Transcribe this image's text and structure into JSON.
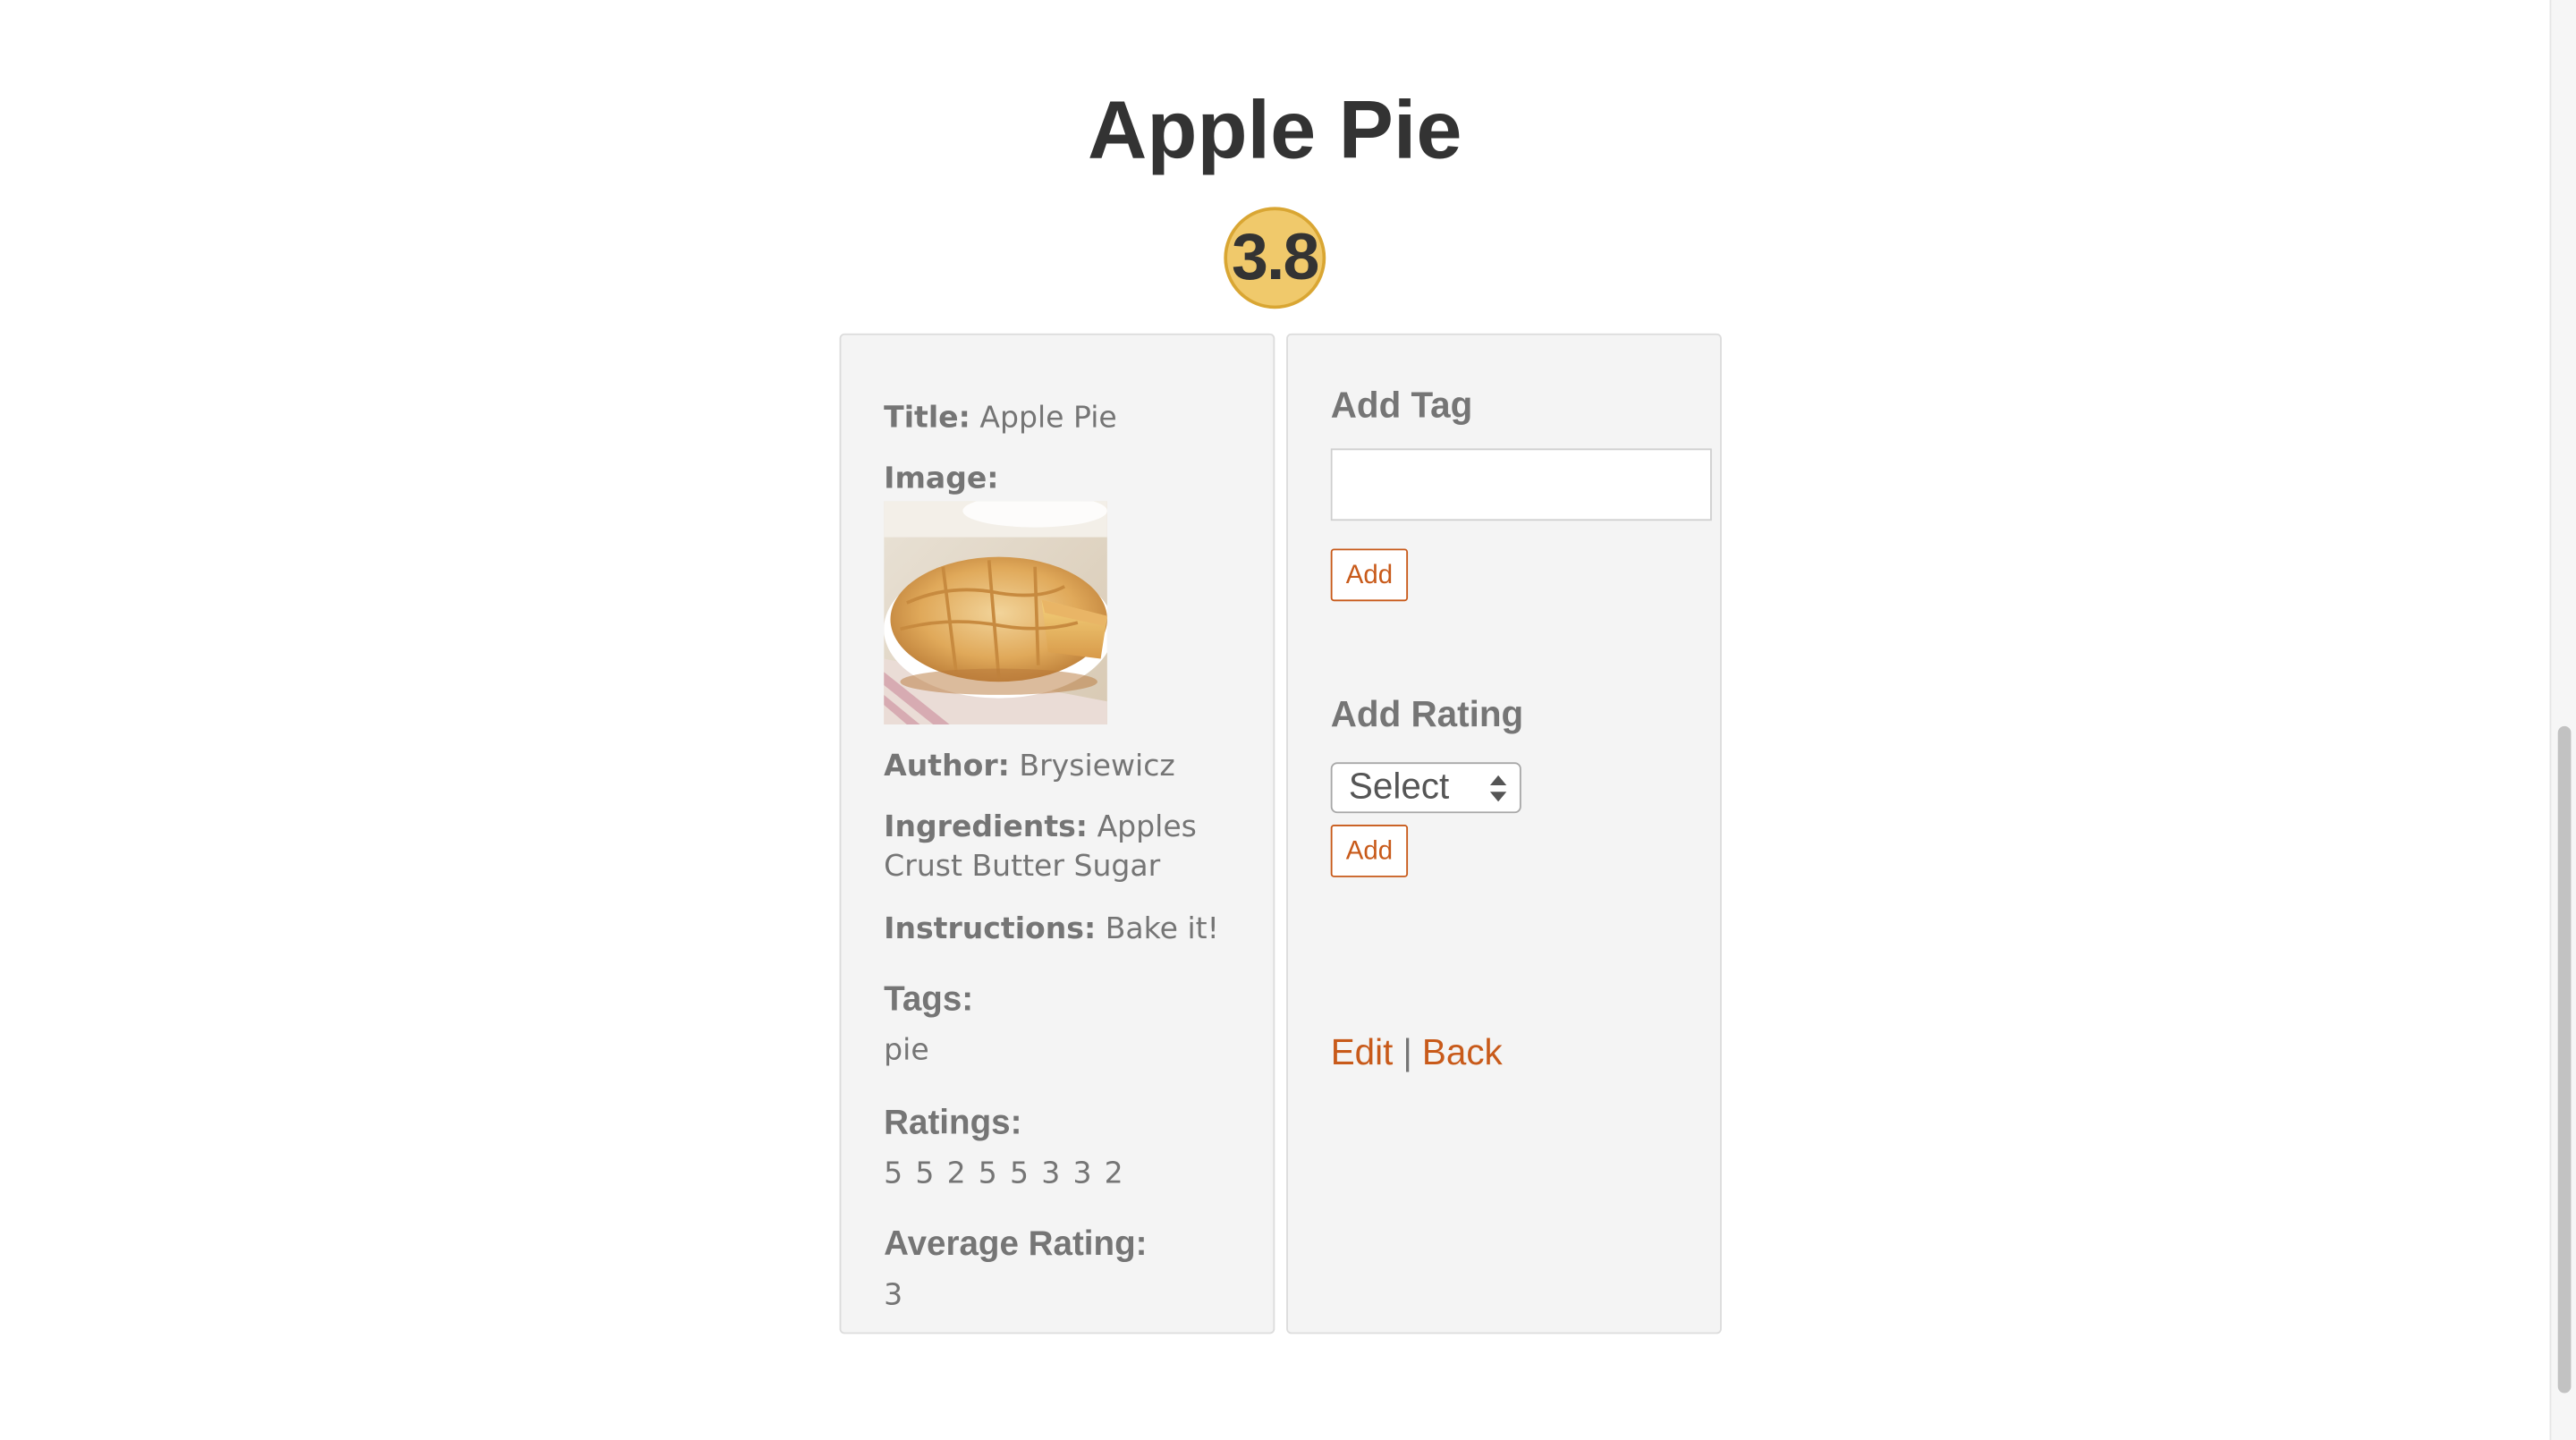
{
  "recipe": {
    "title": "Apple Pie",
    "badge_rating": "3.8"
  },
  "details": {
    "title_label": "Title:",
    "title_value": "Apple Pie",
    "image_label": "Image:",
    "image_alt": "apple pie photo",
    "author_label": "Author:",
    "author_value": "Brysiewicz",
    "ingredients_label": "Ingredients:",
    "ingredients_value": "Apples Crust Butter Sugar",
    "instructions_label": "Instructions:",
    "instructions_value": "Bake it!",
    "tags_label": "Tags:",
    "tags_value": "pie",
    "ratings_label": "Ratings:",
    "ratings_value": "5 5 2 5 5 3 3 2",
    "average_label": "Average Rating:",
    "average_value": "3"
  },
  "add_tag": {
    "heading": "Add Tag",
    "input_value": "",
    "input_placeholder": "",
    "button_label": "Add"
  },
  "add_rating": {
    "heading": "Add Rating",
    "select_value": "Select",
    "button_label": "Add"
  },
  "footer_links": {
    "edit_label": "Edit",
    "separator": "|",
    "back_label": "Back"
  },
  "colors": {
    "accent": "#c85a1a",
    "badge_fill": "#f0c96b",
    "badge_border": "#d9a633",
    "panel_bg": "#f4f4f4",
    "text_muted": "#757575",
    "title_text": "#333333"
  },
  "icons": {
    "select_arrows": "up-down-arrows-icon"
  }
}
